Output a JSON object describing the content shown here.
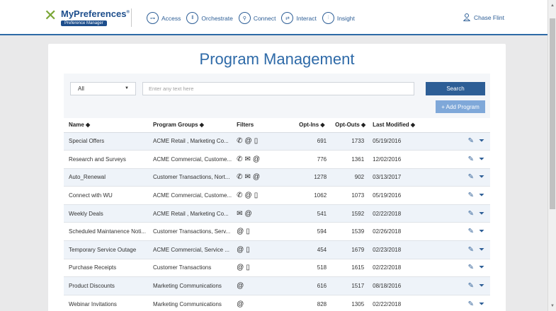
{
  "brand": {
    "name": "MyPreferences",
    "trademark": "®",
    "tagline": "Preference Manager",
    "logo_icon": "x-logo-icon"
  },
  "nav": [
    {
      "label": "Access",
      "icon": "key-icon",
      "glyph": "⊶"
    },
    {
      "label": "Orchestrate",
      "icon": "orchestrate-icon",
      "glyph": "⦀"
    },
    {
      "label": "Connect",
      "icon": "connect-icon",
      "glyph": "⚲"
    },
    {
      "label": "Interact",
      "icon": "interact-icon",
      "glyph": "⇄"
    },
    {
      "label": "Insight",
      "icon": "insight-chart-icon",
      "glyph": "⫶"
    }
  ],
  "user": {
    "name": "Chase Flint",
    "icon": "user-icon"
  },
  "page": {
    "title": "Program Management"
  },
  "filter": {
    "selected": "All",
    "placeholder": "Enter any text here",
    "search_label": "Search",
    "add_label": "+ Add Program"
  },
  "columns": {
    "name": "Name ◆",
    "groups": "Program Groups ◆",
    "filters": "Filters",
    "optins": "Opt-Ins ◆",
    "optouts": "Opt-Outs ◆",
    "modified": "Last Modified ◆"
  },
  "rows": [
    {
      "name": "Special Offers",
      "groups": "ACME Retail , Marketing Co...",
      "filters": [
        "phone-icon",
        "at-icon",
        "mobile-icon"
      ],
      "optins": "691",
      "optouts": "1733",
      "modified": "05/19/2016"
    },
    {
      "name": "Research and Surveys",
      "groups": "ACME Commercial, Custome...",
      "filters": [
        "phone-icon",
        "envelope-icon",
        "at-icon"
      ],
      "optins": "776",
      "optouts": "1361",
      "modified": "12/02/2016"
    },
    {
      "name": "Auto_Renewal",
      "groups": "Customer Transactions, Nort...",
      "filters": [
        "phone-icon",
        "envelope-icon",
        "at-icon"
      ],
      "optins": "1278",
      "optouts": "902",
      "modified": "03/13/2017"
    },
    {
      "name": "Connect with WU",
      "groups": "ACME Commercial, Custome...",
      "filters": [
        "phone-icon",
        "at-icon",
        "mobile-icon"
      ],
      "optins": "1062",
      "optouts": "1073",
      "modified": "05/19/2016"
    },
    {
      "name": "Weekly Deals",
      "groups": "ACME Retail , Marketing Co...",
      "filters": [
        "envelope-icon",
        "at-icon"
      ],
      "optins": "541",
      "optouts": "1592",
      "modified": "02/22/2018"
    },
    {
      "name": "Scheduled Maintanence Noti...",
      "groups": "Customer Transactions, Serv...",
      "filters": [
        "at-icon",
        "mobile-icon"
      ],
      "optins": "594",
      "optouts": "1539",
      "modified": "02/26/2018"
    },
    {
      "name": "Temporary Service Outage",
      "groups": "ACME Commercial, Service ...",
      "filters": [
        "at-icon",
        "mobile-icon"
      ],
      "optins": "454",
      "optouts": "1679",
      "modified": "02/23/2018"
    },
    {
      "name": "Purchase Receipts",
      "groups": "Customer Transactions",
      "filters": [
        "at-icon",
        "mobile-icon"
      ],
      "optins": "518",
      "optouts": "1615",
      "modified": "02/22/2018"
    },
    {
      "name": "Product Discounts",
      "groups": "Marketing Communications",
      "filters": [
        "at-icon"
      ],
      "optins": "616",
      "optouts": "1517",
      "modified": "08/18/2016"
    },
    {
      "name": "Webinar Invitations",
      "groups": "Marketing Communications",
      "filters": [
        "at-icon"
      ],
      "optins": "828",
      "optouts": "1305",
      "modified": "02/22/2018"
    }
  ],
  "row_actions": [
    "edit-icon",
    "filter-add-icon"
  ],
  "colors": {
    "brand_blue": "#2d5e96",
    "title_blue": "#2e6aa8",
    "logo_green": "#7aa636",
    "add_button": "#7fa8d9"
  }
}
